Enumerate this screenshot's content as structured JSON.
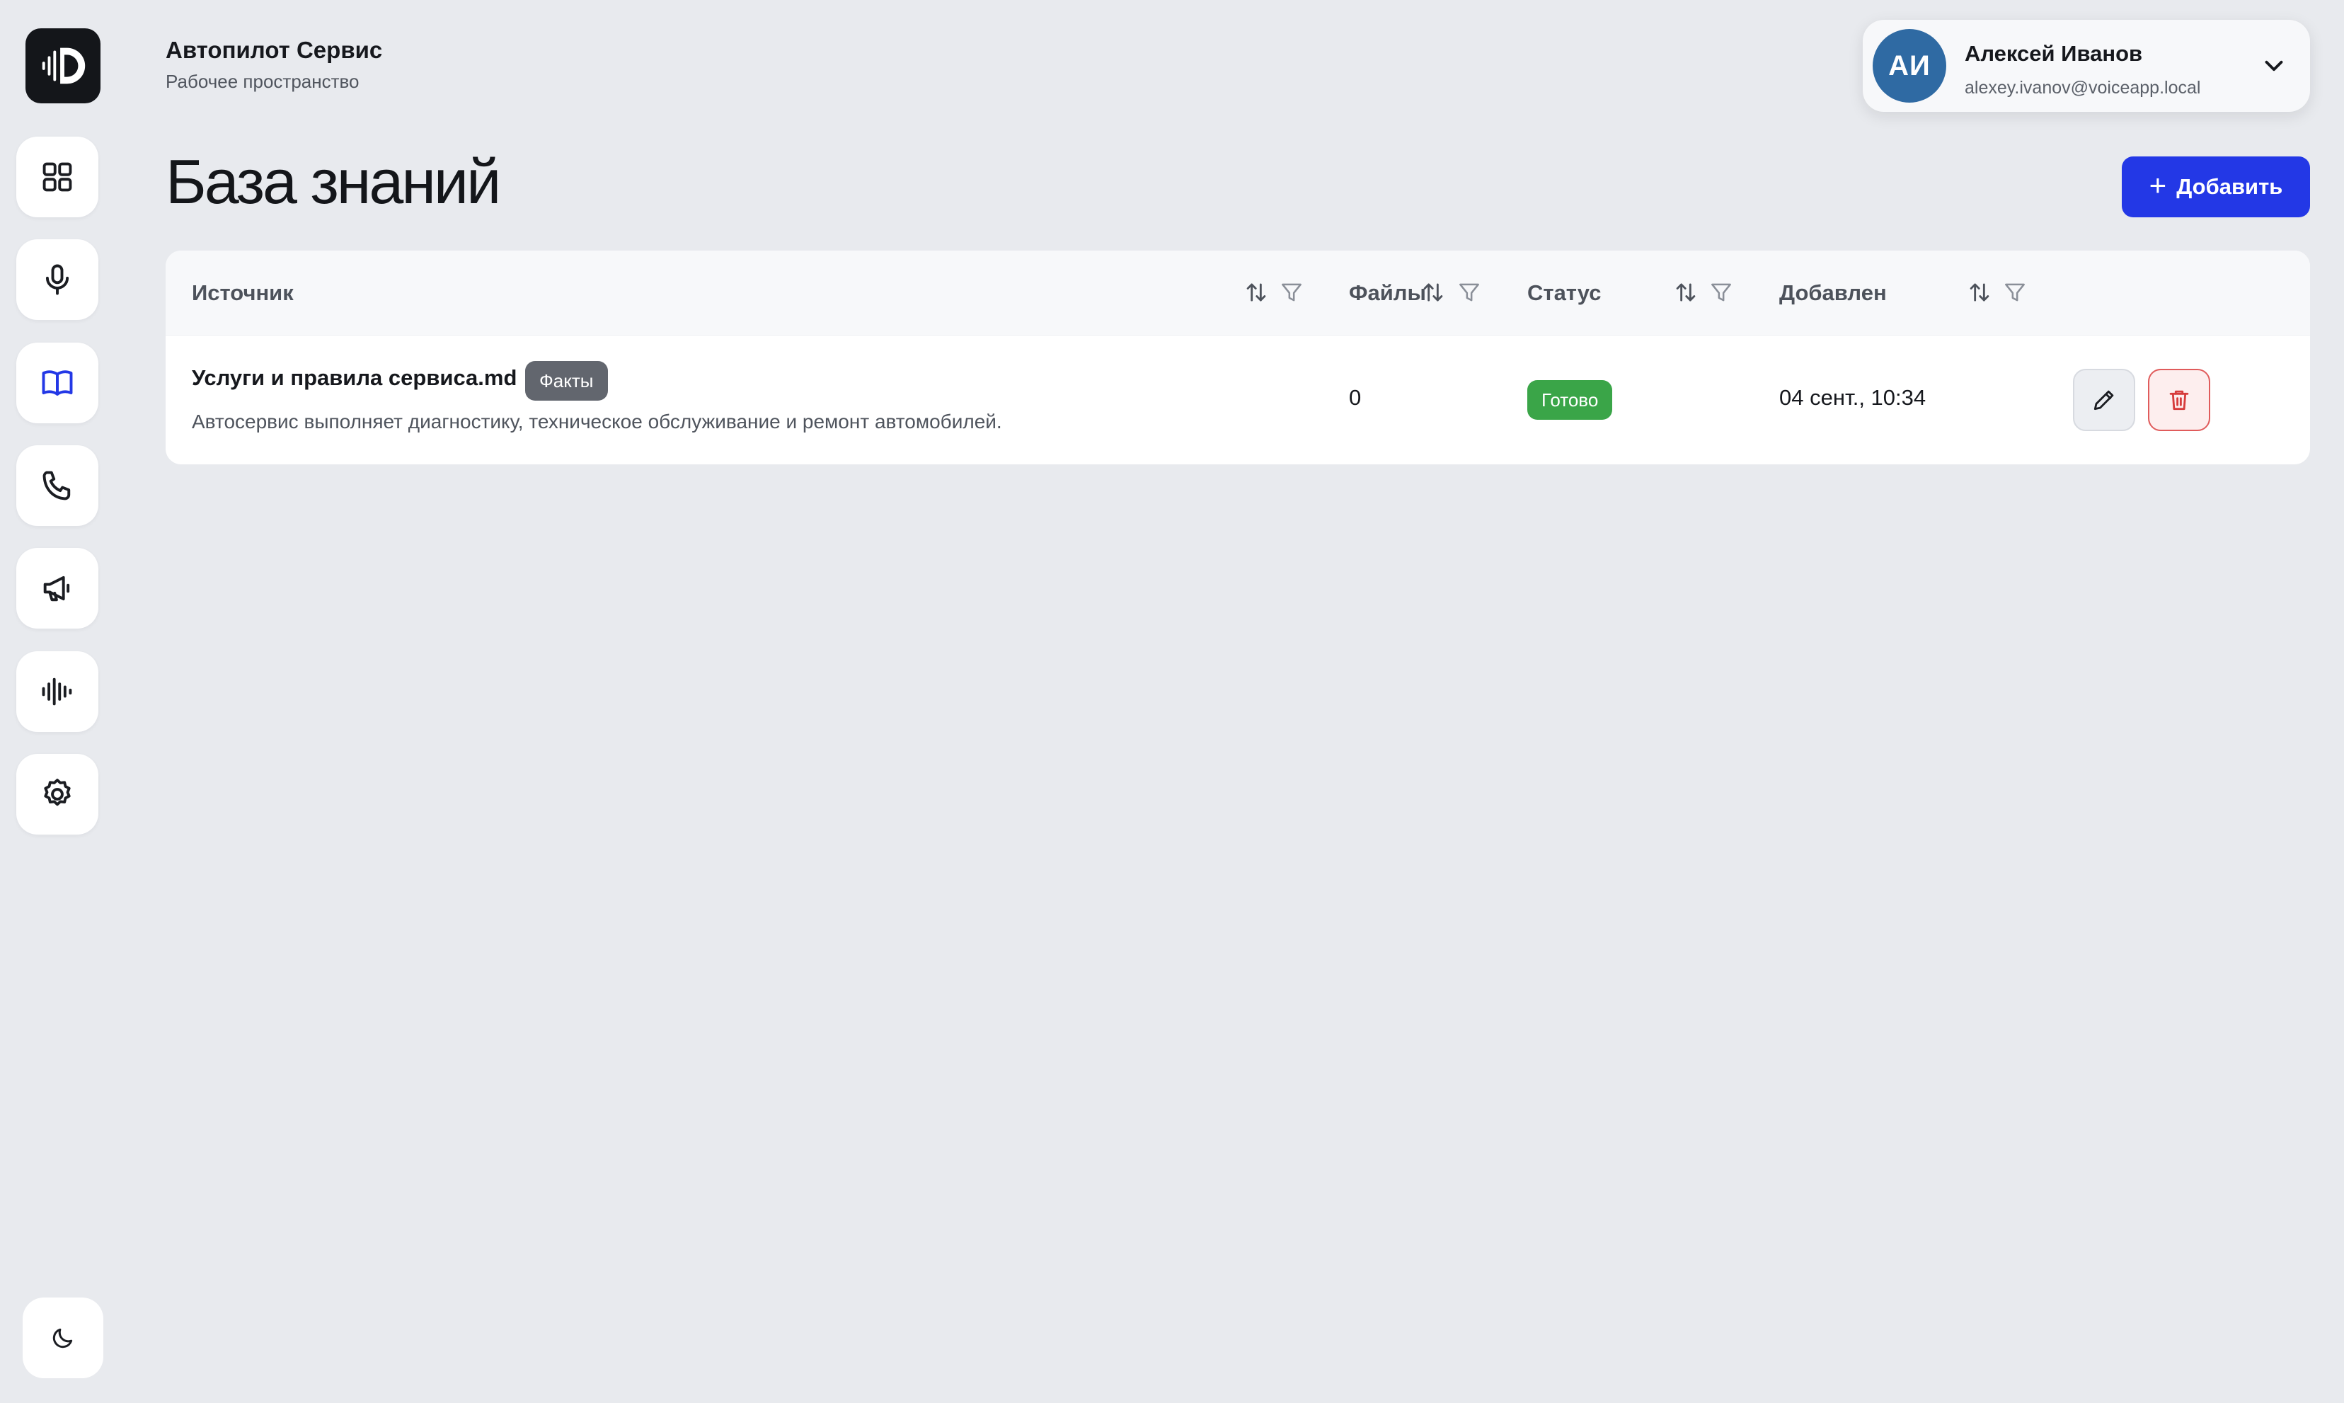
{
  "header": {
    "org_name": "Автопилот Сервис",
    "org_subtitle": "Рабочее пространство"
  },
  "user": {
    "initials": "АИ",
    "name": "Алексей Иванов",
    "email": "alexey.ivanov@voiceapp.local",
    "avatar_color": "#2f6aa3"
  },
  "sidebar": {
    "items": [
      {
        "icon": "grid-icon",
        "active": false
      },
      {
        "icon": "microphone-icon",
        "active": false
      },
      {
        "icon": "book-icon",
        "active": true
      },
      {
        "icon": "phone-icon",
        "active": false
      },
      {
        "icon": "megaphone-icon",
        "active": false
      },
      {
        "icon": "waveform-icon",
        "active": false
      },
      {
        "icon": "gear-icon",
        "active": false
      }
    ],
    "theme_toggle_icon": "moon-icon"
  },
  "page": {
    "title": "База знаний",
    "add_button_label": "Добавить"
  },
  "table": {
    "columns": [
      "Источник",
      "Файлы",
      "Статус",
      "Добавлен"
    ],
    "rows": [
      {
        "title": "Услуги и правила сервиса.md",
        "tag": "Факты",
        "description": "Автосервис выполняет диагностику, техническое обслуживание и ремонт автомобилей.",
        "files": "0",
        "status": "Готово",
        "added": "04 сент., 10:34"
      }
    ]
  },
  "colors": {
    "accent": "#2338e6",
    "status_ready": "#3aa548",
    "danger": "#e05b5b",
    "background": "#e8eaee"
  }
}
